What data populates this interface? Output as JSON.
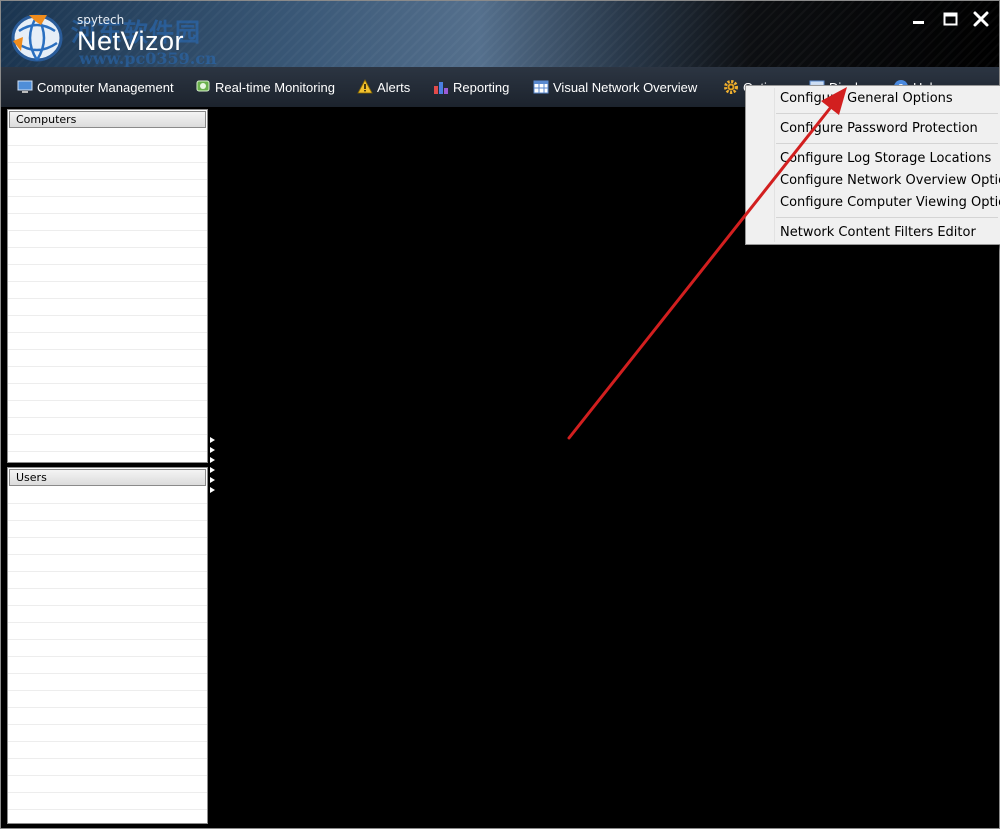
{
  "header": {
    "brand_small": "spytech",
    "brand_name": "NetVizor",
    "watermark_text": "河东软件园",
    "watermark_url": "www.pc0359.cn"
  },
  "window_controls": {
    "icons": [
      "minimize-icon",
      "maximize-icon",
      "close-icon"
    ]
  },
  "menu": {
    "items": [
      {
        "label": "Computer Management",
        "icon": "computer-icon"
      },
      {
        "label": "Real-time Monitoring",
        "icon": "monitor-icon"
      },
      {
        "label": "Alerts",
        "icon": "warning-icon"
      },
      {
        "label": "Reporting",
        "icon": "bar-chart-icon"
      },
      {
        "label": "Visual Network Overview",
        "icon": "network-grid-icon"
      },
      {
        "label": "Options",
        "icon": "gear-icon"
      },
      {
        "label": "Display",
        "icon": "display-icon"
      },
      {
        "label": "Help",
        "icon": "help-icon"
      }
    ]
  },
  "options_menu": {
    "items": [
      "Configure General Options",
      "Configure Password Protection",
      "Configure Log Storage Locations",
      "Configure Network Overview Options",
      "Configure Computer Viewing Options",
      "Network Content Filters Editor"
    ]
  },
  "panels": {
    "computers": {
      "title": "Computers"
    },
    "users": {
      "title": "Users"
    }
  },
  "colors": {
    "accent_arrow": "#d21f1f",
    "menubar": "#232b35",
    "alert_yellow": "#f2c12e"
  }
}
